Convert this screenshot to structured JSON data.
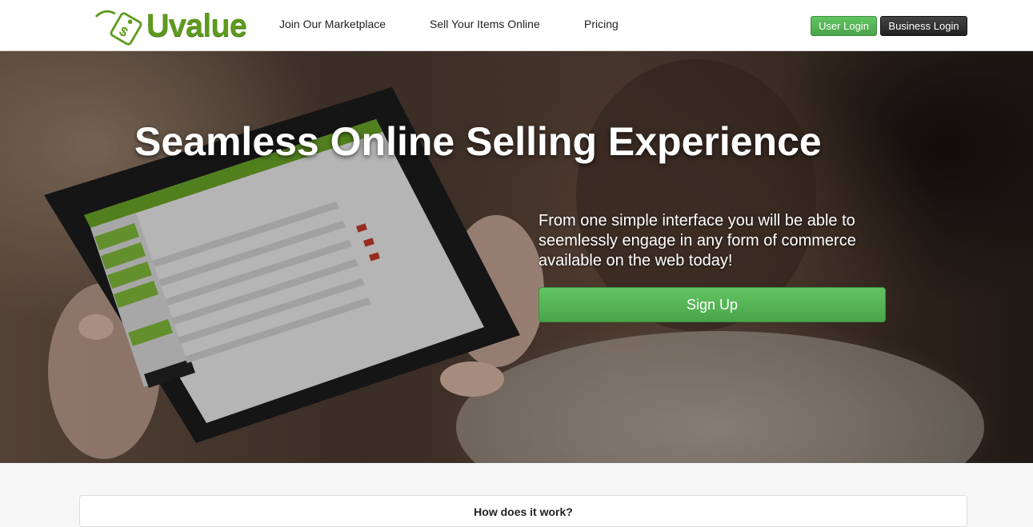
{
  "brand": {
    "name": "Uvalue",
    "logo_color": "#5e9a1e"
  },
  "nav": {
    "links": [
      "Join Our Marketplace",
      "Sell Your Items Online",
      "Pricing"
    ],
    "user_login": "User Login",
    "business_login": "Business Login"
  },
  "hero": {
    "title": "Seamless Online Selling Experience",
    "text": "From one simple interface you will be able to seemlessly engage in any form of commerce available on the web today!",
    "signup": "Sign Up"
  },
  "section": {
    "title": "How does it work?"
  },
  "colors": {
    "green": "#5cb85c",
    "dark": "#222222"
  }
}
